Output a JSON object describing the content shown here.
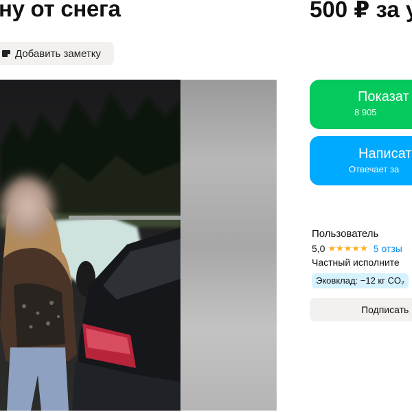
{
  "listing": {
    "title": "ну от снега",
    "price": "500 ₽ за у",
    "add_note_label": "Добавить заметку"
  },
  "contact": {
    "show_phone_label": "Показат",
    "phone_partial": "8 905",
    "write_label": "Написат",
    "response_note": "Отвечает за"
  },
  "seller": {
    "name": "Пользователь",
    "rating_value": "5,0",
    "stars": "★★★★★",
    "reviews": "5 отзы",
    "type": "Частный исполните",
    "eco_badge": "Эковклад: −12 кг CO₂",
    "subscribe_label": "Подписать"
  },
  "colors": {
    "green": "#04c95c",
    "blue": "#00aaff",
    "star": "#ffb021",
    "link": "#0a8df0",
    "eco_bg": "#d7f2ff"
  },
  "icons": {
    "note": "note-tag-icon"
  }
}
